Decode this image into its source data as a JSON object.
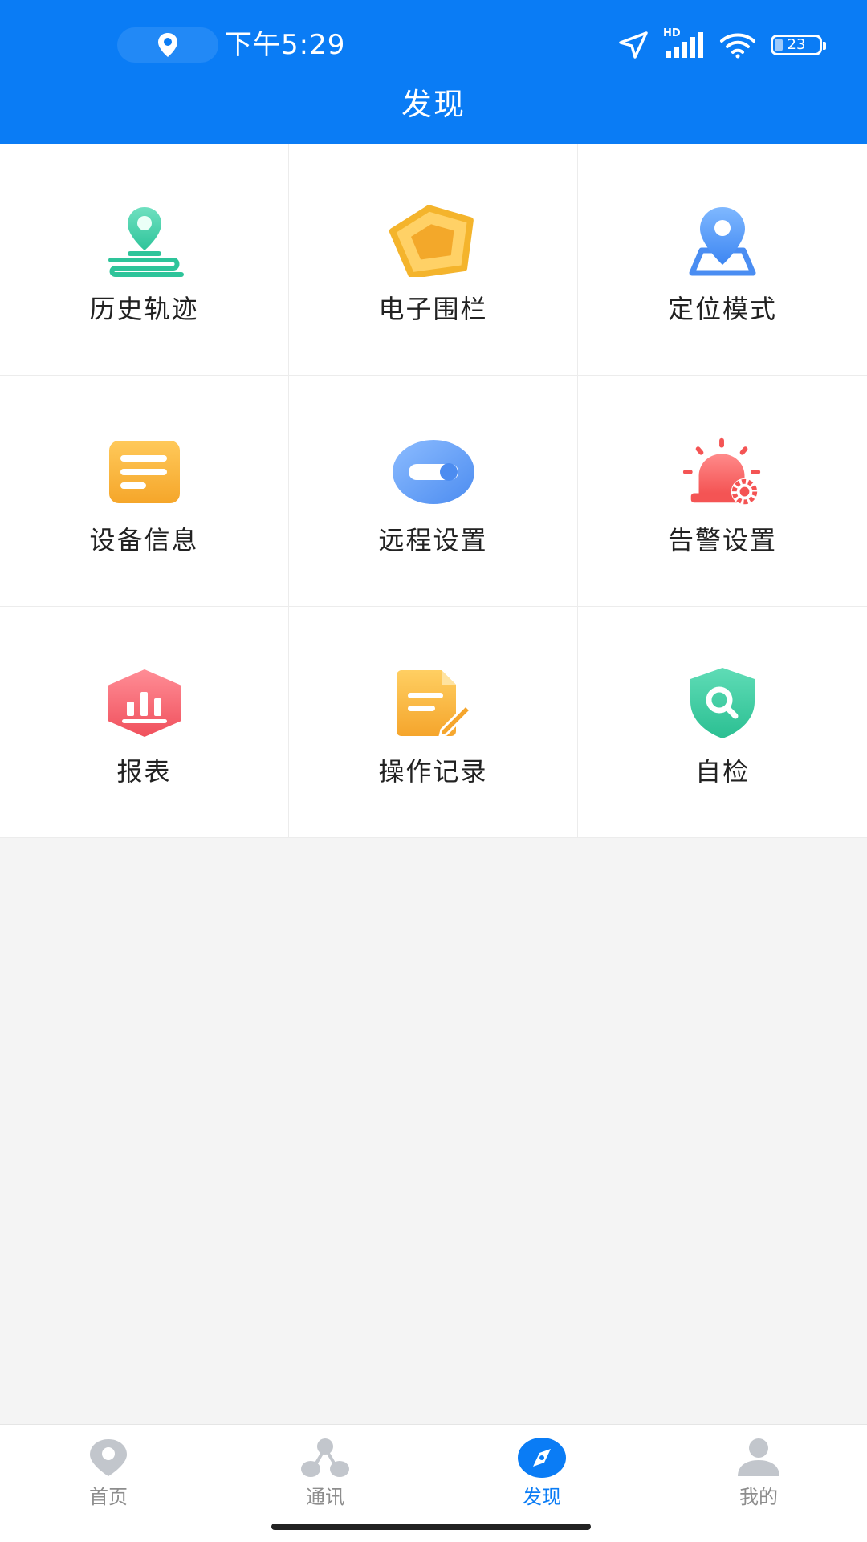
{
  "status_bar": {
    "time": "下午5:29",
    "network": "HD",
    "battery": "23"
  },
  "header": {
    "title": "发现"
  },
  "grid": {
    "items": [
      {
        "label": "历史轨迹",
        "icon": "history-track-icon"
      },
      {
        "label": "电子围栏",
        "icon": "geofence-icon"
      },
      {
        "label": "定位模式",
        "icon": "location-mode-icon"
      },
      {
        "label": "设备信息",
        "icon": "device-info-icon"
      },
      {
        "label": "远程设置",
        "icon": "remote-settings-icon"
      },
      {
        "label": "告警设置",
        "icon": "alarm-settings-icon"
      },
      {
        "label": "报表",
        "icon": "report-icon"
      },
      {
        "label": "操作记录",
        "icon": "operation-record-icon"
      },
      {
        "label": "自检",
        "icon": "self-check-icon"
      }
    ]
  },
  "bottom_nav": {
    "items": [
      {
        "label": "首页",
        "icon": "home-location-icon"
      },
      {
        "label": "通讯",
        "icon": "contacts-icon"
      },
      {
        "label": "发现",
        "icon": "compass-icon",
        "active": true
      },
      {
        "label": "我的",
        "icon": "profile-icon"
      }
    ]
  },
  "colors": {
    "primary": "#0a7cf5",
    "background": "#f4f4f4",
    "nav_inactive": "#8d8d8d"
  }
}
